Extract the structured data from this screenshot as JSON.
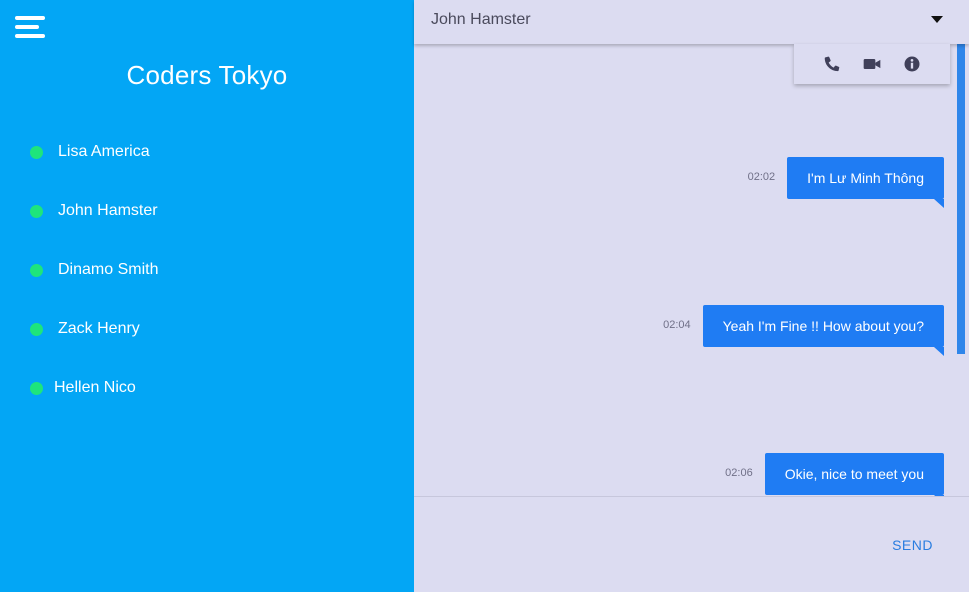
{
  "sidebar": {
    "title": "Coders Tokyo",
    "menu_icon": "hamburger-menu-icon",
    "status_color": "#1ee57c",
    "contacts": [
      {
        "name": "Lisa America"
      },
      {
        "name": "John Hamster"
      },
      {
        "name": "Dinamo Smith"
      },
      {
        "name": "Zack Henry"
      },
      {
        "name": "Hellen Nico"
      }
    ]
  },
  "header": {
    "contact_name": "John Hamster",
    "dropdown_icon": "caret-down-icon",
    "actions": [
      {
        "icon": "phone-icon"
      },
      {
        "icon": "video-camera-icon"
      },
      {
        "icon": "info-icon"
      }
    ]
  },
  "messages": [
    {
      "time": "02:02",
      "text": "I'm Lư Minh Thông"
    },
    {
      "time": "02:04",
      "text": "Yeah I'm Fine !! How about you?"
    },
    {
      "time": "02:06",
      "text": "Okie, nice to meet you"
    }
  ],
  "composer": {
    "placeholder": "",
    "send_label": "SEND"
  },
  "colors": {
    "sidebar": "#03a6f5",
    "bubble": "#1f7cf3",
    "chat_background": "#dcdcf1",
    "accent": "#2a7de0"
  }
}
